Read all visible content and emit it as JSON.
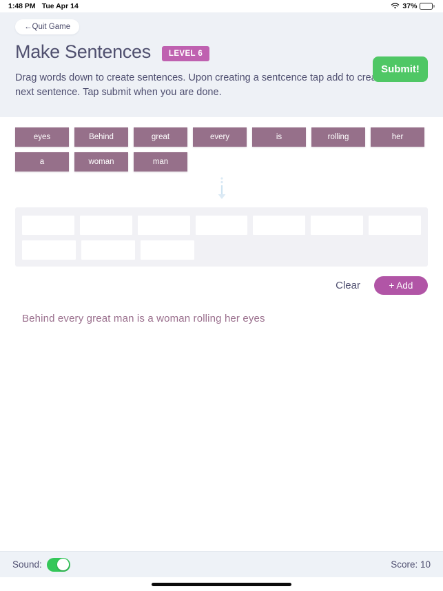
{
  "statusbar": {
    "time": "1:48 PM",
    "date": "Tue Apr 14",
    "battery_percent": "37%",
    "wifi_icon": "wifi-icon",
    "battery_icon": "battery-icon"
  },
  "header": {
    "quit_label": "←Quit Game",
    "title": "Make Sentences",
    "level_badge": "LEVEL 6",
    "submit_label": "Submit!",
    "instructions": "Drag words down to create sentences. Upon creating a sentcence tap add to create the next sentence. Tap submit when you are done."
  },
  "word_tiles": {
    "row1": [
      "eyes",
      "Behind",
      "great",
      "every",
      "is",
      "rolling",
      "her"
    ],
    "row2": [
      "a",
      "woman",
      "man"
    ]
  },
  "drag_hint": {
    "icon": "arrow-down-icon"
  },
  "dropzone": {
    "row1_slots": [
      "",
      "",
      "",
      "",
      "",
      "",
      ""
    ],
    "row2_slots": [
      "",
      "",
      ""
    ]
  },
  "actions": {
    "clear_label": "Clear",
    "add_label": "+ Add"
  },
  "sentences": [
    "Behind every great man is a woman rolling her eyes"
  ],
  "footer": {
    "sound_label": "Sound:",
    "sound_on": true,
    "score_label": "Score: 10"
  },
  "colors": {
    "tile": "#96708a",
    "level_badge": "#bf61b0",
    "submit": "#4fc765",
    "add": "#b155a6",
    "header_bg": "#eef1f6",
    "toggle_on": "#34c759",
    "sentence_text": "#9a6f8d"
  }
}
